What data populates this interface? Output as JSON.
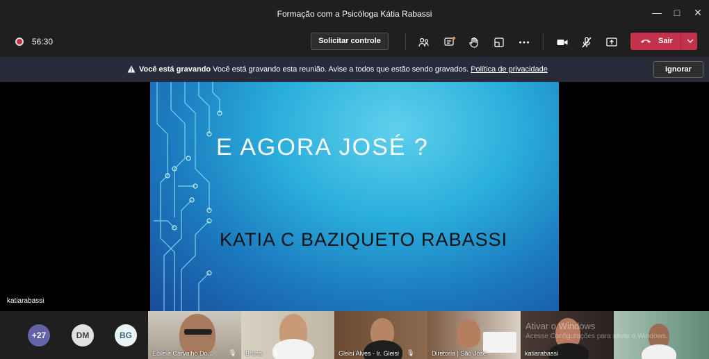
{
  "window": {
    "title": "Formação com a Psicóloga Kátia Rabassi"
  },
  "toolbar": {
    "timer": "56:30",
    "request_control_label": "Solicitar controle",
    "leave_label": "Sair"
  },
  "banner": {
    "bold": "Você está gravando",
    "text": " Você está gravando esta reunião. Avise a todos que estão sendo gravados. ",
    "link": "Política de privacidade",
    "ignore_label": "Ignorar"
  },
  "slide": {
    "title": "E AGORA JOSÉ ?",
    "subtitle": "KATIA C BAZIQUETO RABASSI"
  },
  "presenter_name": "katiarabassi",
  "participants": {
    "overflow": "+27",
    "avatars": [
      {
        "initials": "DM",
        "color": "#e1e1e1"
      },
      {
        "initials": "BG",
        "color": "#e8f3f5"
      }
    ],
    "tiles": [
      {
        "name": "Edileia Carvalho Do..."
      },
      {
        "name": "Bruna"
      },
      {
        "name": "Gleisi Alves - Ir. Gleisi"
      },
      {
        "name": "Diretoria | São José"
      },
      {
        "name": "katiarabassi"
      },
      {
        "name": ""
      }
    ]
  },
  "watermark": {
    "line1": "Ativar o Windows",
    "line2": "Acesse Configurações para ativar o Windows."
  },
  "colors": {
    "accent_leave": "#c4314b",
    "banner_bg": "#292a3a",
    "titlebar_bg": "#1f1f1f"
  }
}
